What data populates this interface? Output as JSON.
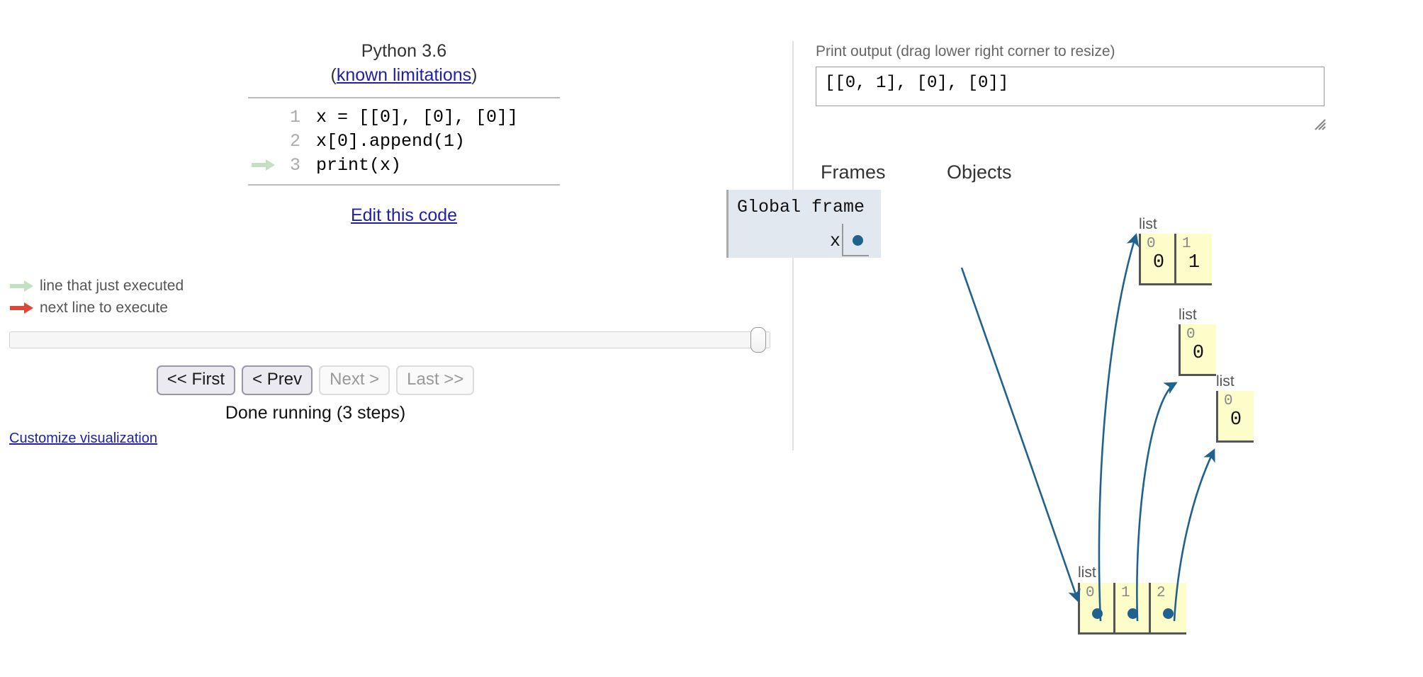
{
  "code_panel": {
    "python_version": "Python 3.6",
    "limitations_prefix": "(",
    "limitations_link": "known limitations",
    "limitations_suffix": ")",
    "lines": [
      {
        "number": "1",
        "text": "x = [[0], [0], [0]]",
        "marker": "none"
      },
      {
        "number": "2",
        "text": "x[0].append(1)",
        "marker": "none"
      },
      {
        "number": "3",
        "text": "print(x)",
        "marker": "green"
      }
    ],
    "edit_code_label": "Edit this code"
  },
  "legend": {
    "just_executed": "line that just executed",
    "next_to_execute": "next line to execute",
    "green_color": "#c3e0c3",
    "red_color": "#d9493a"
  },
  "controls": {
    "buttons": [
      {
        "label": "<< First",
        "enabled": true
      },
      {
        "label": "< Prev",
        "enabled": true
      },
      {
        "label": "Next >",
        "enabled": false
      },
      {
        "label": "Last >>",
        "enabled": false
      }
    ],
    "status": "Done running (3 steps)",
    "customize_label": "Customize visualization",
    "slider_position_percent": 100
  },
  "output_panel": {
    "print_output_label": "Print output (drag lower right corner to resize)",
    "print_output_value": "[[0, 1], [0], [0]]"
  },
  "viz": {
    "frames_header": "Frames",
    "objects_header": "Objects",
    "global_frame": {
      "title": "Global frame",
      "variables": [
        {
          "name": "x",
          "value_kind": "pointer"
        }
      ]
    },
    "objects": [
      {
        "id": "list-a",
        "type_label": "list",
        "cells": [
          {
            "index": "0",
            "value": "0",
            "kind": "value"
          },
          {
            "index": "1",
            "value": "1",
            "kind": "value"
          }
        ]
      },
      {
        "id": "list-b",
        "type_label": "list",
        "cells": [
          {
            "index": "0",
            "value": "0",
            "kind": "value"
          }
        ]
      },
      {
        "id": "list-c",
        "type_label": "list",
        "cells": [
          {
            "index": "0",
            "value": "0",
            "kind": "value"
          }
        ]
      },
      {
        "id": "list-outer",
        "type_label": "list",
        "cells": [
          {
            "index": "0",
            "value": "",
            "kind": "pointer"
          },
          {
            "index": "1",
            "value": "",
            "kind": "pointer"
          },
          {
            "index": "2",
            "value": "",
            "kind": "pointer"
          }
        ]
      }
    ],
    "colors": {
      "frame_bg": "#e2e8f0",
      "object_bg": "#fdfdca",
      "object_border": "#555555",
      "pointer": "#1f628e",
      "link": "#2020a8"
    }
  }
}
